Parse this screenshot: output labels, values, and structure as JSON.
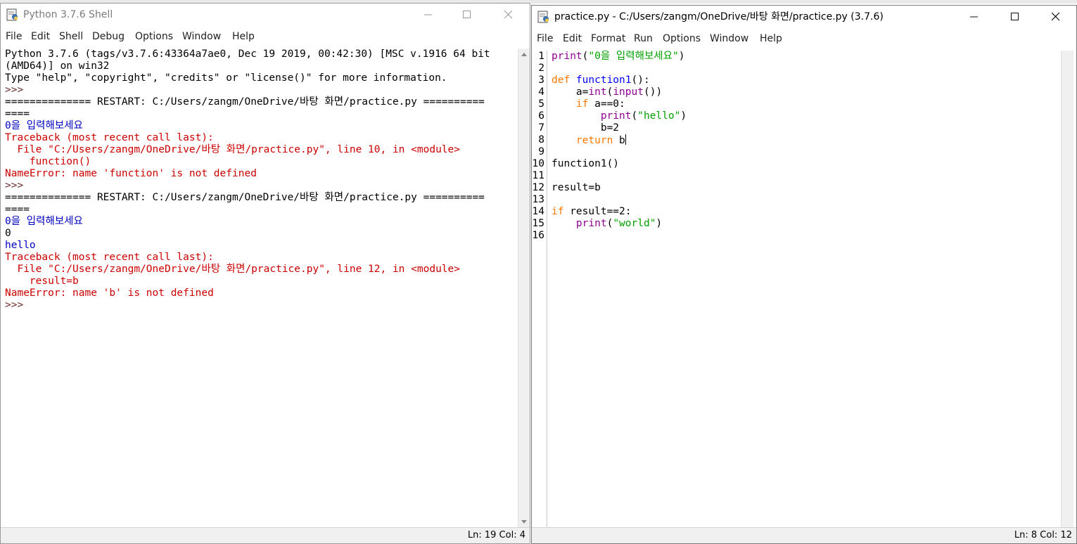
{
  "shell": {
    "title": "Python 3.7.6 Shell",
    "menu": [
      "File",
      "Edit",
      "Shell",
      "Debug",
      "Options",
      "Window",
      "Help"
    ],
    "lines": [
      {
        "t": "Python 3.7.6 (tags/v3.7.6:43364a7ae0, Dec 19 2019, 00:42:30) [MSC v.1916 64 bit",
        "c": "out"
      },
      {
        "t": "(AMD64)] on win32",
        "c": "out"
      },
      {
        "t": "Type \"help\", \"copyright\", \"credits\" or \"license()\" for more information.",
        "c": "out"
      },
      {
        "t": ">>> ",
        "c": "prompt"
      },
      {
        "t": "============== RESTART: C:/Users/zangm/OneDrive/바탕 화면/practice.py ==========",
        "c": "out"
      },
      {
        "t": "====",
        "c": "out"
      },
      {
        "t": "0을 입력해보세요",
        "c": "stdout"
      },
      {
        "t": "Traceback (most recent call last):",
        "c": "err"
      },
      {
        "t": "  File \"C:/Users/zangm/OneDrive/바탕 화면/practice.py\", line 10, in <module>",
        "c": "err"
      },
      {
        "t": "    function()",
        "c": "err"
      },
      {
        "t": "NameError: name 'function' is not defined",
        "c": "err"
      },
      {
        "t": ">>> ",
        "c": "prompt"
      },
      {
        "t": "============== RESTART: C:/Users/zangm/OneDrive/바탕 화면/practice.py ==========",
        "c": "out"
      },
      {
        "t": "====",
        "c": "out"
      },
      {
        "t": "0을 입력해보세요",
        "c": "stdout"
      },
      {
        "t": "0",
        "c": "out"
      },
      {
        "t": "hello",
        "c": "stdout"
      },
      {
        "t": "Traceback (most recent call last):",
        "c": "err"
      },
      {
        "t": "  File \"C:/Users/zangm/OneDrive/바탕 화면/practice.py\", line 12, in <module>",
        "c": "err"
      },
      {
        "t": "    result=b",
        "c": "err"
      },
      {
        "t": "NameError: name 'b' is not defined",
        "c": "err"
      },
      {
        "t": ">>> ",
        "c": "prompt"
      }
    ],
    "status": "Ln: 19   Col: 4"
  },
  "editor": {
    "title": "practice.py - C:/Users/zangm/OneDrive/바탕 화면/practice.py (3.7.6)",
    "menu": [
      "File",
      "Edit",
      "Format",
      "Run",
      "Options",
      "Window",
      "Help"
    ],
    "line_numbers": [
      "1",
      "2",
      "3",
      "4",
      "5",
      "6",
      "7",
      "8",
      "9",
      "10",
      "11",
      "12",
      "13",
      "14",
      "15",
      "16"
    ],
    "code": [
      [
        {
          "t": "print",
          "c": "bi"
        },
        {
          "t": "(",
          "c": "norm"
        },
        {
          "t": "\"0을 입력해보세요\"",
          "c": "str"
        },
        {
          "t": ")",
          "c": "norm"
        }
      ],
      [],
      [
        {
          "t": "def ",
          "c": "key"
        },
        {
          "t": "function1",
          "c": "def"
        },
        {
          "t": "():",
          "c": "norm"
        }
      ],
      [
        {
          "t": "    a=",
          "c": "norm"
        },
        {
          "t": "int",
          "c": "bi"
        },
        {
          "t": "(",
          "c": "norm"
        },
        {
          "t": "input",
          "c": "bi"
        },
        {
          "t": "())",
          "c": "norm"
        }
      ],
      [
        {
          "t": "    ",
          "c": "norm"
        },
        {
          "t": "if",
          "c": "key"
        },
        {
          "t": " a==0:",
          "c": "norm"
        }
      ],
      [
        {
          "t": "        ",
          "c": "norm"
        },
        {
          "t": "print",
          "c": "bi"
        },
        {
          "t": "(",
          "c": "norm"
        },
        {
          "t": "\"hello\"",
          "c": "str"
        },
        {
          "t": ")",
          "c": "norm"
        }
      ],
      [
        {
          "t": "        b=2",
          "c": "norm"
        }
      ],
      [
        {
          "t": "    ",
          "c": "norm"
        },
        {
          "t": "return",
          "c": "key"
        },
        {
          "t": " b",
          "c": "norm"
        }
      ],
      [],
      [
        {
          "t": "function1()",
          "c": "norm"
        }
      ],
      [],
      [
        {
          "t": "result=b",
          "c": "norm"
        }
      ],
      [],
      [
        {
          "t": "if",
          "c": "key"
        },
        {
          "t": " result==2:",
          "c": "norm"
        }
      ],
      [
        {
          "t": "    ",
          "c": "norm"
        },
        {
          "t": "print",
          "c": "bi"
        },
        {
          "t": "(",
          "c": "norm"
        },
        {
          "t": "\"world\"",
          "c": "str"
        },
        {
          "t": ")",
          "c": "norm"
        }
      ],
      []
    ],
    "cursor_line": 8,
    "status": "Ln: 8   Col: 12"
  }
}
